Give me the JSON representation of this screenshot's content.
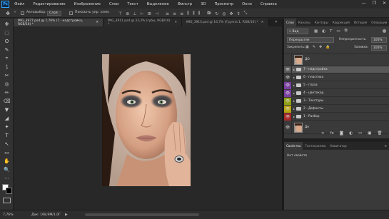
{
  "app": {
    "logo": "Ps"
  },
  "menu": [
    "Файл",
    "Редактирование",
    "Изображение",
    "Слои",
    "Текст",
    "Выделение",
    "Фильтр",
    "3D",
    "Просмотр",
    "Окно",
    "Справка"
  ],
  "window_controls": [
    "—",
    "❐",
    "✕"
  ],
  "options_bar": {
    "autoselect_label": "Автовыбор:",
    "autoselect_value": "Слой",
    "show_controls_label": "Показать упр. элем."
  },
  "tabs": [
    {
      "label": "IMG_3977.psd @ 7,76% (7 - надстройка, RGB/16) *",
      "active": true
    },
    {
      "label": "IMG_3911.psd @ 33,3% (губы, RGB/16) *",
      "active": false
    },
    {
      "label": "IMG_3913.psd @ 16,7% (Группа 1, RGB/16) *",
      "active": false
    }
  ],
  "status": {
    "zoom": "7,76%",
    "doc": "Док: 168,9M/1,0Г"
  },
  "layers_panel": {
    "tabs": [
      "Слои",
      "Каналы",
      "Контуры",
      "Коррекция",
      "История",
      "Операции"
    ],
    "filter_value": "Вид",
    "blend_mode": "Перекрытие",
    "opacity_label": "Непрозрачность:",
    "opacity_value": "100%",
    "lock_label": "Закрепить:",
    "fill_label": "Заливка:",
    "fill_value": "100%",
    "layers": [
      {
        "name": "ДО",
        "type": "image",
        "visible": false,
        "color": ""
      },
      {
        "name": "7 - надстройка",
        "type": "group",
        "visible": true,
        "color": "",
        "selected": true
      },
      {
        "name": "6 - пластика",
        "type": "group",
        "visible": true,
        "color": ""
      },
      {
        "name": "5 - глаза",
        "type": "group",
        "visible": true,
        "color": "#7a3fa0"
      },
      {
        "name": "4 - цветокор.",
        "type": "group",
        "visible": true,
        "color": "#7a3fa0"
      },
      {
        "name": "3 - Текстуры",
        "type": "group",
        "visible": true,
        "color": "#8fa016"
      },
      {
        "name": "2 - Дефекты",
        "type": "group",
        "visible": true,
        "color": "#b8a412"
      },
      {
        "name": "1 - Разбор",
        "type": "group",
        "visible": true,
        "color": "#a82828"
      },
      {
        "name": "Де",
        "type": "image",
        "visible": true,
        "color": ""
      }
    ],
    "bottom_icons": [
      "link-icon",
      "fx-icon",
      "mask-icon",
      "adjustment-icon",
      "folder-icon",
      "new-layer-icon",
      "trash-icon"
    ],
    "bottom_glyphs": [
      "∞",
      "fx",
      "◙",
      "◐",
      "▭",
      "▣",
      "🗑"
    ]
  },
  "props_panel": {
    "tabs": [
      "Свойства",
      "Гистограмма",
      "Навигатор"
    ],
    "empty_text": "Нет свойств"
  },
  "tools": [
    "✥",
    "⬚",
    "ʘ",
    "✎",
    "⌖",
    "⟆",
    "✂",
    "◎",
    "✏",
    "⌫",
    "▼",
    "◢",
    "✦",
    "T",
    "↖",
    "▭",
    "✋",
    "🔍",
    "⋯"
  ],
  "colors": {
    "accent": "#31a8ff",
    "panel": "#3a3a3a",
    "selected_row": "#585858"
  }
}
